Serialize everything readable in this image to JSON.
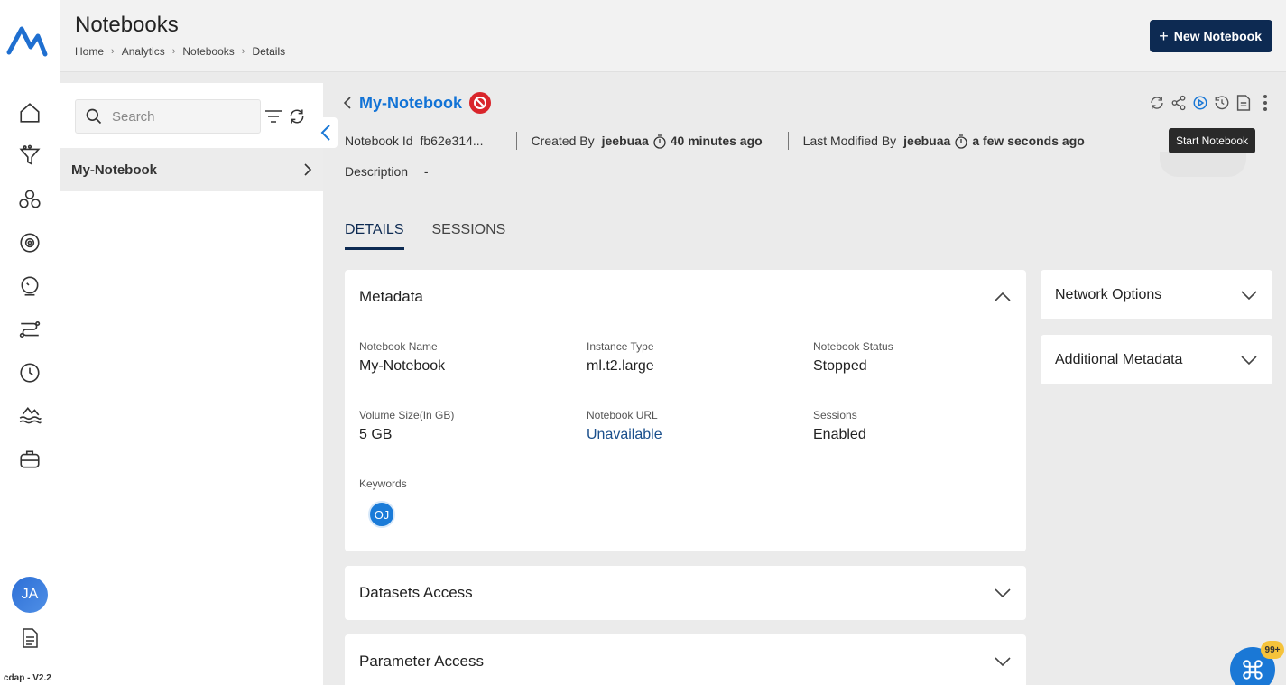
{
  "app": {
    "version": "cdap - V2.2"
  },
  "user": {
    "initials": "JA"
  },
  "header": {
    "title": "Notebooks",
    "breadcrumb": [
      "Home",
      "Analytics",
      "Notebooks",
      "Details"
    ],
    "new_button_label": "New Notebook"
  },
  "sidebar": {
    "items": [
      {
        "icon": "home-icon"
      },
      {
        "icon": "funnel-icon"
      },
      {
        "icon": "cluster-icon"
      },
      {
        "icon": "settings-target-icon"
      },
      {
        "icon": "lab-icon"
      },
      {
        "icon": "workflow-icon"
      },
      {
        "icon": "clock-icon"
      },
      {
        "icon": "lake-icon"
      },
      {
        "icon": "briefcase-icon"
      }
    ],
    "bottom_icon": "document-icon"
  },
  "list_panel": {
    "search_placeholder": "Search",
    "items": [
      {
        "label": "My-Notebook"
      }
    ]
  },
  "notebook": {
    "name": "My-Notebook",
    "id_label": "Notebook Id",
    "id_value": "fb62e314...",
    "created_by_label": "Created By",
    "created_by": "jeebuaa",
    "created_ago": "40 minutes ago",
    "modified_by_label": "Last Modified By",
    "modified_by": "jeebuaa",
    "modified_ago": "a few seconds ago",
    "description_label": "Description",
    "description_value": "-"
  },
  "tooltip": "Start Notebook",
  "tabs": [
    {
      "label": "DETAILS",
      "active": true
    },
    {
      "label": "SESSIONS",
      "active": false
    }
  ],
  "metadata": {
    "title": "Metadata",
    "fields": {
      "name_label": "Notebook Name",
      "name_value": "My-Notebook",
      "instance_label": "Instance Type",
      "instance_value": "ml.t2.large",
      "status_label": "Notebook Status",
      "status_value": "Stopped",
      "volume_label": "Volume Size(In GB)",
      "volume_value": "5 GB",
      "url_label": "Notebook URL",
      "url_value": "Unavailable",
      "sessions_label": "Sessions",
      "sessions_value": "Enabled",
      "keywords_label": "Keywords",
      "keyword_chip": "OJ"
    }
  },
  "sections": {
    "datasets": "Datasets Access",
    "parameters": "Parameter Access",
    "network": "Network Options",
    "additional": "Additional Metadata"
  },
  "fab": {
    "badge": "99+"
  },
  "colors": {
    "brand": "#0d2a52",
    "accent": "#1273d6",
    "stop": "#d9252b"
  }
}
